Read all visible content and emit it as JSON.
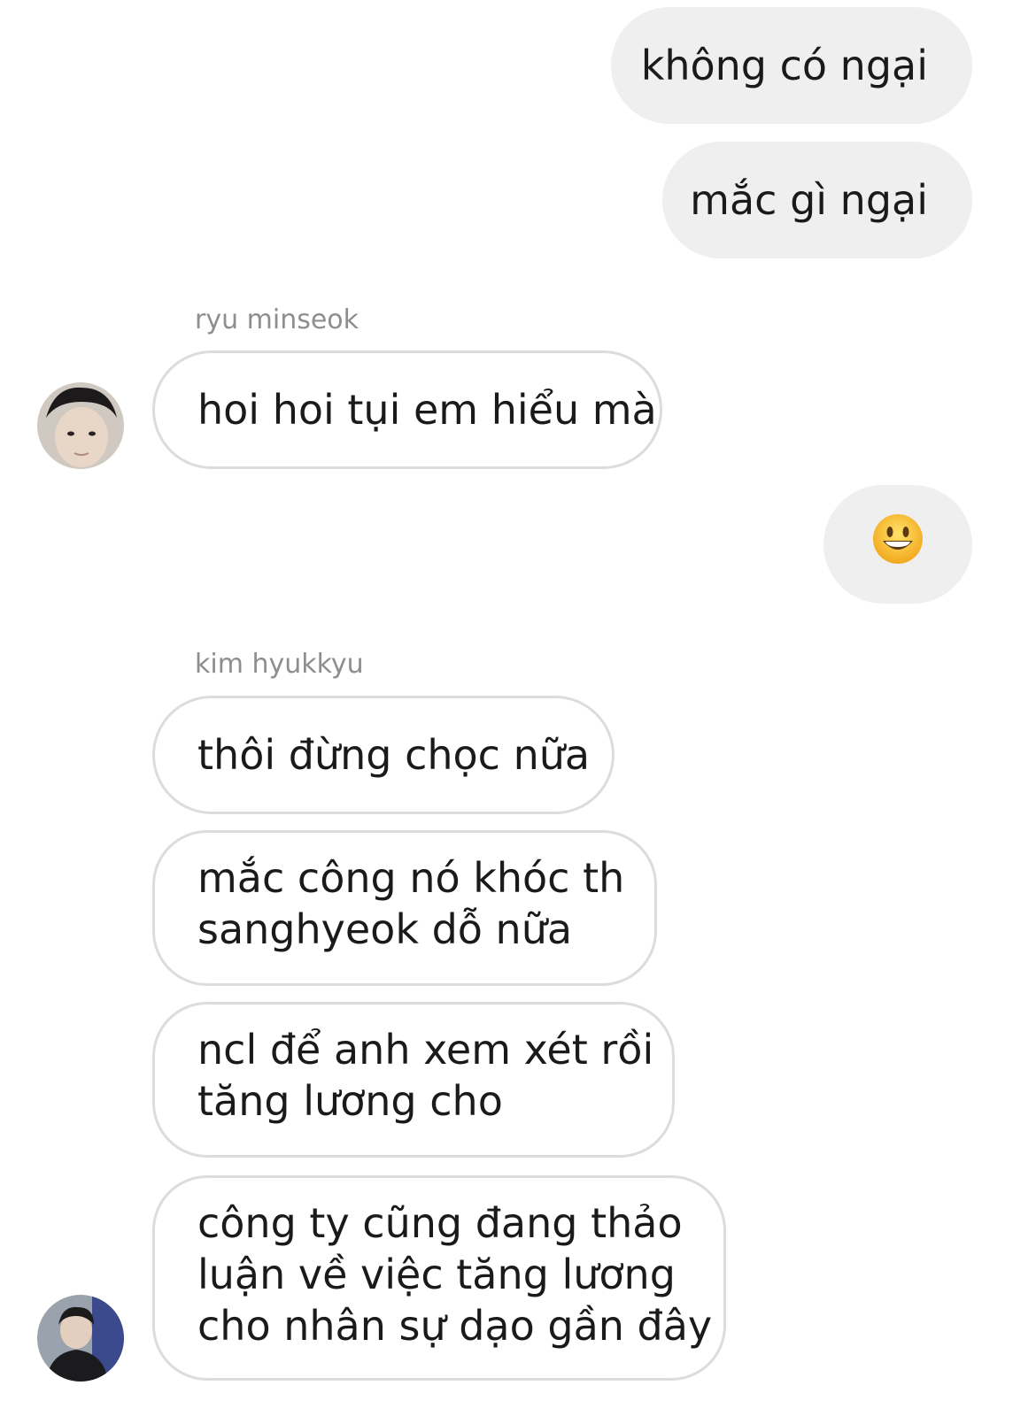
{
  "messages": {
    "out1": "không có ngại",
    "out2": "mắc gì ngại",
    "sender1": "ryu minseok",
    "in1": "hoi hoi tụi em hiểu mà",
    "out_emoji": "😀",
    "sender2": "kim hyukkyu",
    "in2": "thôi đừng chọc nữa",
    "in3_lines": [
      "mắc công nó khóc th",
      "sanghyeok dỗ nữa"
    ],
    "in4_lines": [
      "ncl để anh xem xét rồi",
      "tăng lương cho"
    ],
    "in5_lines": [
      "công ty cũng đang thảo",
      "luận về việc tăng lương",
      "cho nhân sự dạo gần đây"
    ]
  },
  "colors": {
    "outgoing_bubble": "#efefef",
    "incoming_border": "#dcdcdc",
    "sender_name": "#8e8e8e",
    "text": "#1a1a1a"
  },
  "icons": {
    "avatar1": "user-avatar-ryu-minseok",
    "avatar2": "user-avatar-kim-hyukkyu",
    "emoji": "grinning-face-emoji"
  }
}
